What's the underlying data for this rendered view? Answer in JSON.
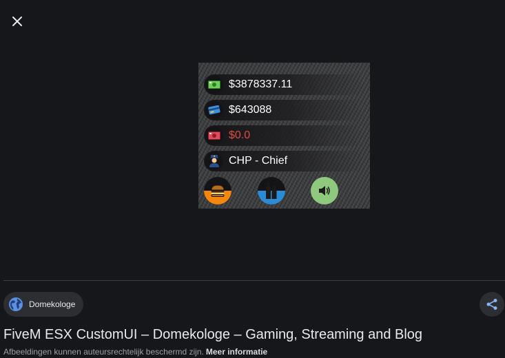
{
  "viewer": {
    "close_icon": "close-icon"
  },
  "hud": {
    "cash": "$3878337.11",
    "bank": "$643088",
    "black_money": "$0.0",
    "job": "CHP - Chief",
    "icons": [
      "cash-icon",
      "bank-card-icon",
      "black-money-icon",
      "police-officer-icon"
    ],
    "status_icons": [
      "burger-icon",
      "bottle-icon",
      "speaker-icon"
    ],
    "colors": {
      "hunger": "#f5860f",
      "thirst": "#2a8bd6",
      "voice": "#8ec97e",
      "negative": "#e04a3f"
    },
    "hunger_level": 0.5,
    "thirst_level": 0.5
  },
  "source": {
    "name": "Domekologe",
    "icon": "globe-icon"
  },
  "share_icon": "share-icon",
  "title": "FiveM ESX CustomUI – Domekologe – Gaming, Streaming and Blog",
  "notice": {
    "text": "Afbeeldingen kunnen auteursrechtelijk beschermd zijn.",
    "link": "Meer informatie"
  }
}
